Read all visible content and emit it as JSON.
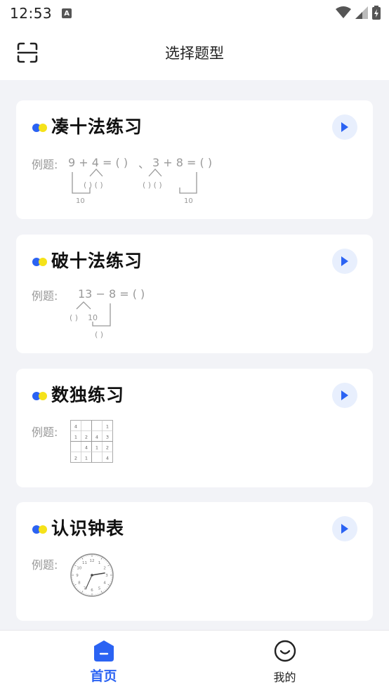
{
  "status_bar": {
    "time": "12:53",
    "notification_glyph": "A"
  },
  "nav": {
    "title": "选择题型"
  },
  "example_label": "例题:",
  "cards": [
    {
      "title": "凑十法练习",
      "example": {
        "expr1": "9 + 4 = (    )",
        "separator": "、",
        "expr2": "3 + 8 = (    )",
        "split_slots1": "( ) ( )",
        "split_slots2": "( ) ( )",
        "ten1": "10",
        "ten2": "10"
      }
    },
    {
      "title": "破十法练习",
      "example": {
        "expr": "13 − 8 = (    )",
        "split_slot": "( )",
        "ten": "10",
        "result_slot": "( )"
      }
    },
    {
      "title": "数独练习",
      "example": {
        "grid": [
          [
            "4",
            "",
            "",
            "1"
          ],
          [
            "1",
            "2",
            "4",
            "3"
          ],
          [
            "",
            "4",
            "1",
            "2"
          ],
          [
            "2",
            "1",
            "",
            "4"
          ]
        ]
      }
    },
    {
      "title": "认识钟表",
      "example": {
        "numbers": [
          "12",
          "1",
          "2",
          "3",
          "4",
          "5",
          "6",
          "7",
          "8",
          "9",
          "10",
          "11"
        ]
      }
    }
  ],
  "tabs": [
    {
      "label": "首页",
      "active": true
    },
    {
      "label": "我的",
      "active": false
    }
  ],
  "colors": {
    "accent": "#2b63f3",
    "dot_blue": "#2b63f3",
    "dot_yellow": "#f5e21a",
    "play_bg": "#e8effd",
    "muted": "#999999",
    "background": "#f2f3f7"
  }
}
